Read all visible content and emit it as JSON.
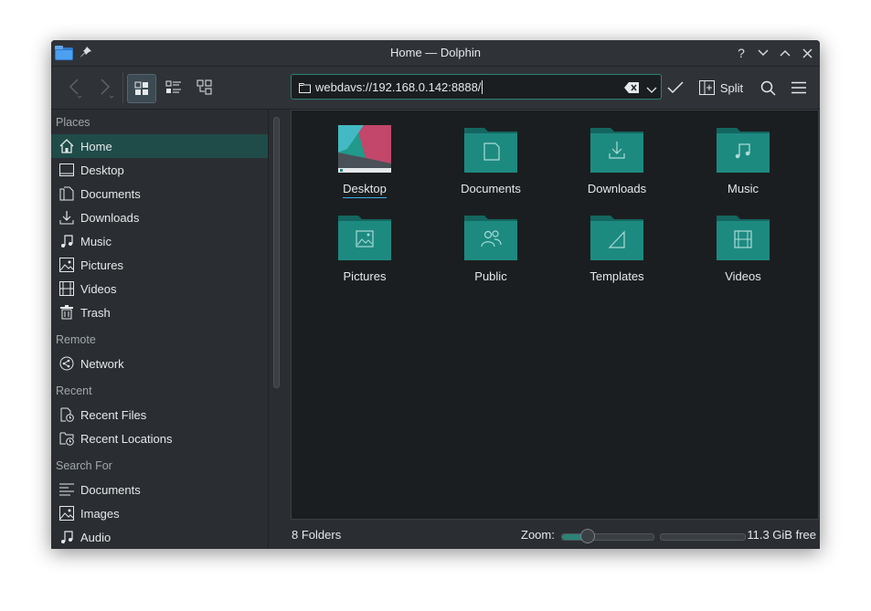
{
  "window": {
    "title": "Home — Dolphin"
  },
  "toolbar": {
    "location": "webdavs://192.168.0.142:8888/",
    "split_label": "Split"
  },
  "sidebar": {
    "places": {
      "title": "Places",
      "items": [
        {
          "label": "Home",
          "icon": "home-icon"
        },
        {
          "label": "Desktop",
          "icon": "desktop-icon"
        },
        {
          "label": "Documents",
          "icon": "documents-icon"
        },
        {
          "label": "Downloads",
          "icon": "downloads-icon"
        },
        {
          "label": "Music",
          "icon": "music-icon"
        },
        {
          "label": "Pictures",
          "icon": "pictures-icon"
        },
        {
          "label": "Videos",
          "icon": "videos-icon"
        },
        {
          "label": "Trash",
          "icon": "trash-icon"
        }
      ]
    },
    "remote": {
      "title": "Remote",
      "items": [
        {
          "label": "Network",
          "icon": "network-icon"
        }
      ]
    },
    "recent": {
      "title": "Recent",
      "items": [
        {
          "label": "Recent Files",
          "icon": "recent-files-icon"
        },
        {
          "label": "Recent Locations",
          "icon": "recent-locations-icon"
        }
      ]
    },
    "search": {
      "title": "Search For",
      "items": [
        {
          "label": "Documents",
          "icon": "text-documents-icon"
        },
        {
          "label": "Images",
          "icon": "images-icon"
        },
        {
          "label": "Audio",
          "icon": "audio-icon"
        }
      ]
    }
  },
  "content": {
    "folders": [
      {
        "name": "Desktop",
        "icon": "desktop-thumbnail"
      },
      {
        "name": "Documents",
        "icon": "folder-documents-icon"
      },
      {
        "name": "Downloads",
        "icon": "folder-downloads-icon"
      },
      {
        "name": "Music",
        "icon": "folder-music-icon"
      },
      {
        "name": "Pictures",
        "icon": "folder-pictures-icon"
      },
      {
        "name": "Public",
        "icon": "folder-public-icon"
      },
      {
        "name": "Templates",
        "icon": "folder-templates-icon"
      },
      {
        "name": "Videos",
        "icon": "folder-videos-icon"
      }
    ]
  },
  "statusbar": {
    "summary": "8 Folders",
    "zoom_label": "Zoom:",
    "zoom_fraction": 0.28,
    "free_space": "11.3 GiB free"
  },
  "colors": {
    "accent": "#2c8377",
    "folder": "#1d8a80",
    "folder_dark": "#136760",
    "active_place": "#1f4c48"
  }
}
